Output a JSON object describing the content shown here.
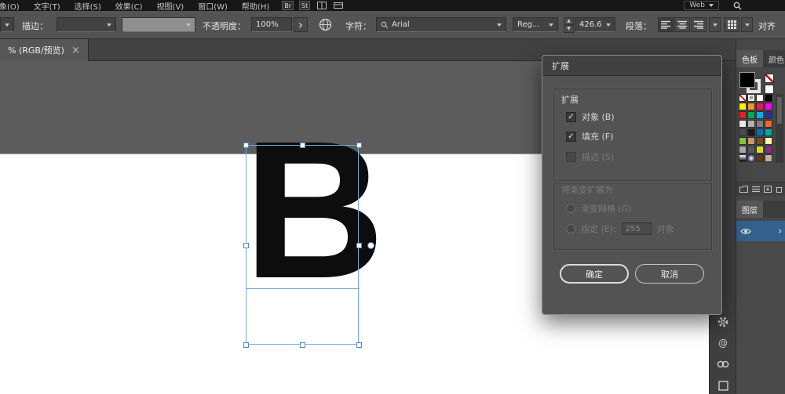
{
  "menubar": {
    "items": [
      "象(O)",
      "文字(T)",
      "选择(S)",
      "效果(C)",
      "视图(V)",
      "窗口(W)",
      "帮助(H)"
    ],
    "bridge_label": "Br",
    "stock_label": "St",
    "workspace_label": "Web"
  },
  "toolbar": {
    "stroke_label": "描边：",
    "opacity_label": "不透明度：",
    "opacity_value": "100%",
    "character_label": "字符：",
    "font_name": "Arial",
    "font_style": "Reg...",
    "font_size": "426.6",
    "paragraph_label": "段落：",
    "align_label": "对齐"
  },
  "document_tab": {
    "title": "% (RGB/预览)",
    "close_glyph": "×"
  },
  "canvas": {
    "letter": "B"
  },
  "dialog": {
    "title": "扩展",
    "expand_section_label": "扩展",
    "object_checkbox_label": "对象 (B)",
    "fill_checkbox_label": "填充 (F)",
    "stroke_checkbox_label": "描边 (S)",
    "gradient_section_label": "将渐变扩展为",
    "gradient_mesh_radio_label": "渐变网格 (G)",
    "specify_radio_label": "指定 (E):",
    "specify_value": "255",
    "specify_suffix_label": "对象",
    "ok_label": "确定",
    "cancel_label": "取消"
  },
  "right_panel": {
    "swatches_tab_label": "色板",
    "color_tab_label": "颜色",
    "layers_tab_label": "图层",
    "layer_chevron_glyph": "›",
    "swatches": [
      "none",
      "registration",
      "#ffffff",
      "#000000",
      "#fff200",
      "#f7941d",
      "#ed145b",
      "#ff00ff",
      "#ed1c24",
      "#00a651",
      "#00aeef",
      "#2e3192",
      "#ececec",
      "#b3b3b3",
      "#7f7f7f",
      "#f26522",
      "#4d4d4d",
      "#1a1a1a",
      "#0072bc",
      "#00a99d",
      "#8dc63f",
      "#c49a6c",
      "#754c24",
      "#fff9ae",
      "#a7a9ac",
      "#58595b",
      "#d7df23",
      "#92278f",
      "grad:linear-gradient(180deg,#ffffff,#000000)",
      "grad:radial-gradient(circle,#ffffff,#1b1464)",
      "#603913",
      "#c7b299"
    ]
  },
  "icons": {
    "check_glyph": "✓",
    "registration_glyph": "⊕",
    "at_glyph": "@"
  },
  "colors": {
    "selection_blue": "#78a7dc",
    "layer_selected_bg": "#33608d",
    "dialog_bg": "#535353"
  }
}
